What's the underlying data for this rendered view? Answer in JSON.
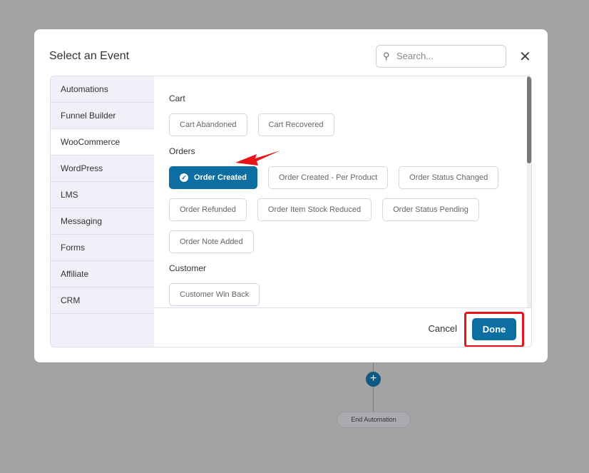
{
  "modal": {
    "title": "Select an Event",
    "search_placeholder": "Search...",
    "close_icon": "close-icon"
  },
  "sidebar": {
    "items": [
      {
        "label": "Automations"
      },
      {
        "label": "Funnel Builder"
      },
      {
        "label": "WooCommerce",
        "active": true
      },
      {
        "label": "WordPress"
      },
      {
        "label": "LMS"
      },
      {
        "label": "Messaging"
      },
      {
        "label": "Forms"
      },
      {
        "label": "Affiliate"
      },
      {
        "label": "CRM"
      }
    ]
  },
  "sections": {
    "cart": {
      "title": "Cart",
      "items": [
        "Cart Abandoned",
        "Cart Recovered"
      ]
    },
    "orders": {
      "title": "Orders",
      "items": [
        "Order Created",
        "Order Created - Per Product",
        "Order Status Changed",
        "Order Refunded",
        "Order Item Stock Reduced",
        "Order Status Pending",
        "Order Note Added"
      ],
      "selected": "Order Created"
    },
    "customer": {
      "title": "Customer",
      "items": [
        "Customer Win Back"
      ]
    }
  },
  "footer": {
    "cancel": "Cancel",
    "done": "Done"
  },
  "background": {
    "plus": "+",
    "end_node": "End Automation"
  },
  "colors": {
    "primary": "#0c6ea1",
    "highlight": "#e8141a"
  }
}
